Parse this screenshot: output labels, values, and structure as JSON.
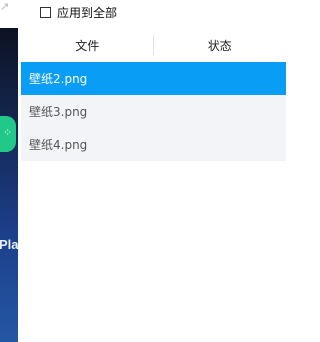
{
  "options": {
    "apply_all_label": "应用到全部",
    "apply_all_checked": false
  },
  "table": {
    "columns": [
      "文件",
      "状态"
    ],
    "rows": [
      {
        "file": "壁纸2.png",
        "status": "",
        "selected": true
      },
      {
        "file": "壁纸3.png",
        "status": "",
        "selected": false
      },
      {
        "file": "壁纸4.png",
        "status": "",
        "selected": false
      }
    ]
  },
  "background": {
    "partial_text": "Pla"
  },
  "colors": {
    "selection": "#0a9df5",
    "row_background": "#f3f4f8"
  }
}
